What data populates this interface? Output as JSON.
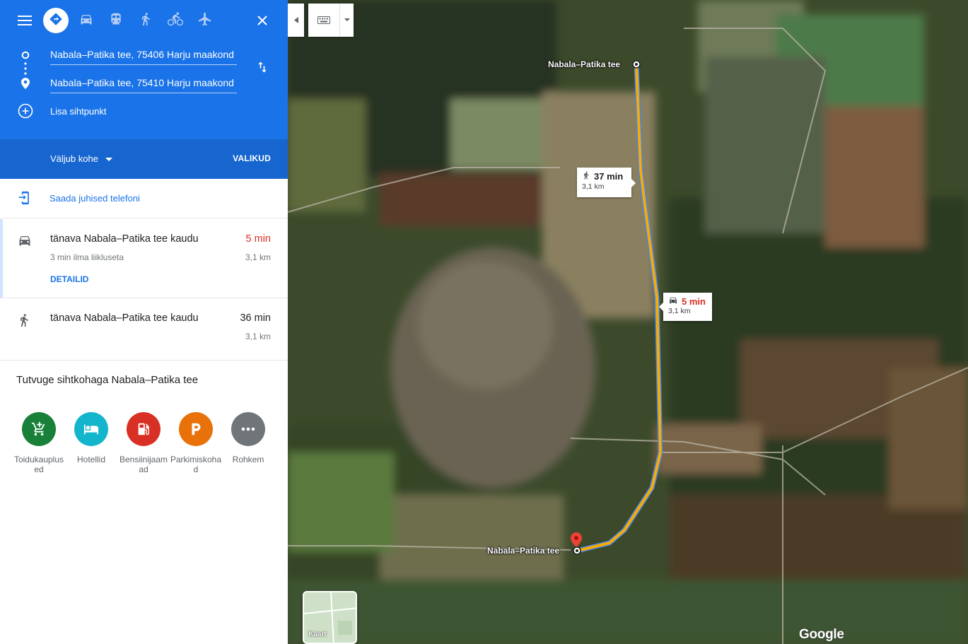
{
  "header": {
    "mode_icons": [
      "menu-icon",
      "directions-icon",
      "car-icon",
      "transit-icon",
      "walking-icon",
      "bicycle-icon",
      "flight-icon",
      "close-icon"
    ],
    "origin_value": "Nabala–Patika tee, 75406 Harju maakond",
    "destination_value": "Nabala–Patika tee, 75410 Harju maakond",
    "add_waypoint_label": "Lisa sihtpunkt",
    "depart_label": "Väljub kohe",
    "options_label": "VALIKUD"
  },
  "send": {
    "label": "Saada juhised telefoni"
  },
  "routes": [
    {
      "mode": "car",
      "via": "tänava Nabala–Patika tee kaudu",
      "time": "5 min",
      "note": "3 min ilma liikluseta",
      "distance": "3,1 km",
      "details_label": "DETAILID"
    },
    {
      "mode": "walk",
      "via": "tänava Nabala–Patika tee kaudu",
      "time": "36 min",
      "distance": "3,1 km"
    }
  ],
  "explore": {
    "title": "Tutvuge sihtkohaga Nabala–Patika tee",
    "categories": [
      {
        "label": "Toidukauplused",
        "icon": "cart-icon",
        "color": "#188038"
      },
      {
        "label": "Hotellid",
        "icon": "bed-icon",
        "color": "#12b5cb"
      },
      {
        "label": "Bensiinijaamad",
        "icon": "gas-station-icon",
        "color": "#d93025"
      },
      {
        "label": "Parkimiskohad",
        "icon": "parking-icon",
        "color": "#e8710a"
      },
      {
        "label": "Rohkem",
        "icon": "more-icon",
        "color": "#70757a"
      }
    ]
  },
  "map": {
    "origin_label": "Nabala–Patika tee",
    "destination_label": "Nabala–Patika tee",
    "walk_callout": {
      "time": "37 min",
      "distance": "3,1 km"
    },
    "car_callout": {
      "time": "5 min",
      "distance": "3,1 km"
    },
    "layer_label": "Kaart",
    "logo": "Google",
    "route_colors": {
      "walk": "#f9ab00",
      "car": "#4285f4"
    }
  }
}
